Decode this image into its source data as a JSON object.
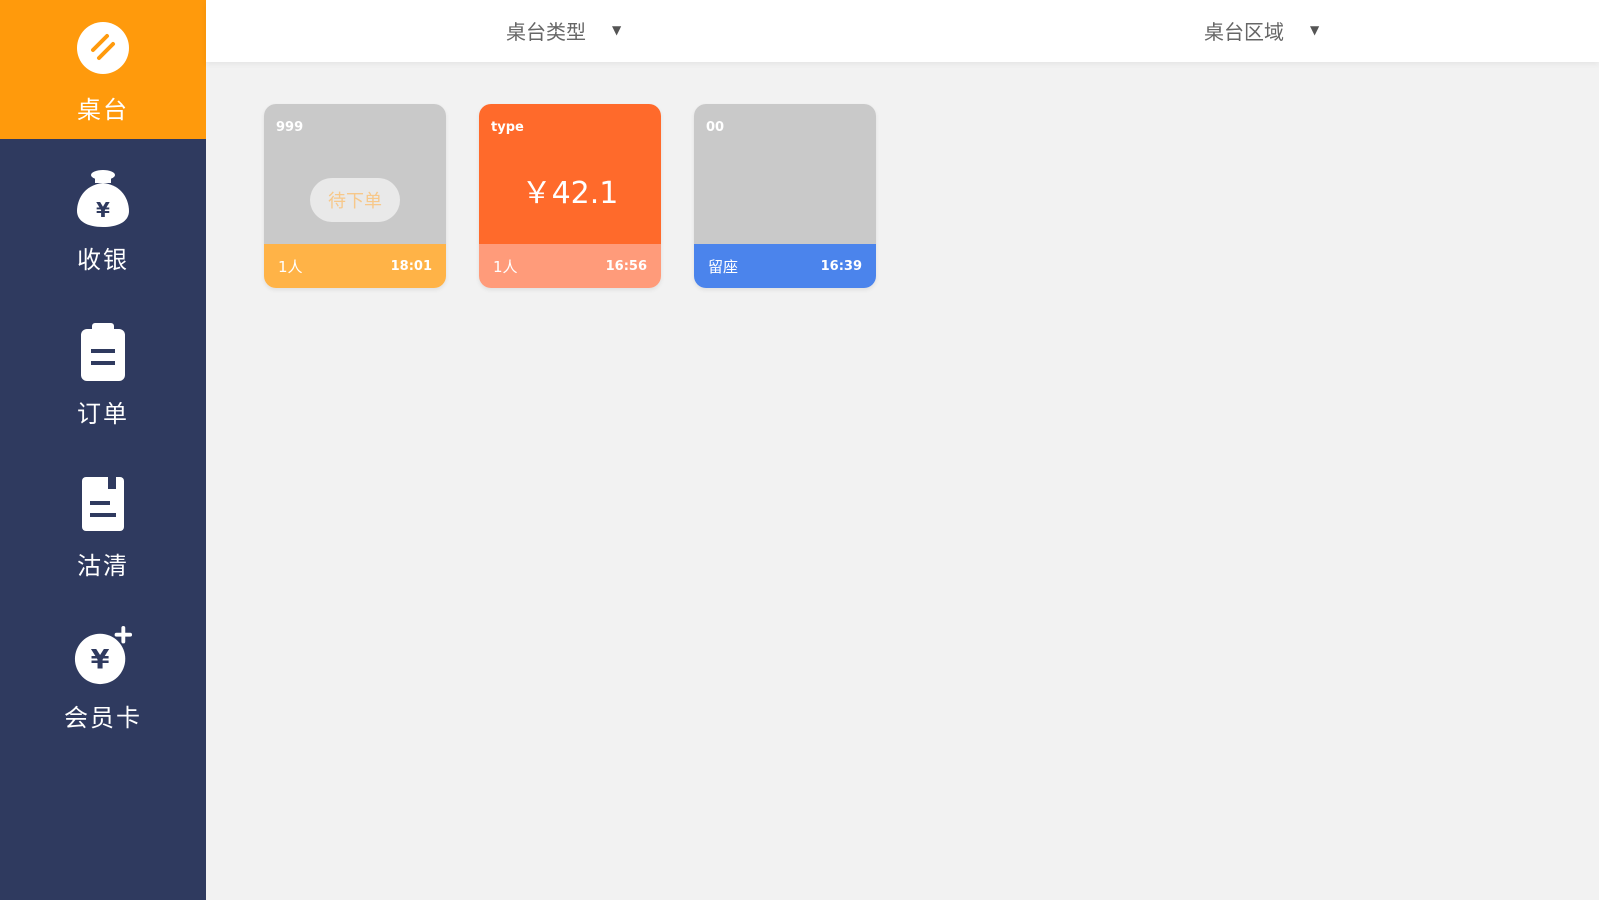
{
  "colors": {
    "sidebar_bg": "#2f3a5f",
    "active_accent": "#ff9a0c",
    "page_bg": "#f2f2f2",
    "card_idle_top": "#c9c9c9",
    "card_pending_bottom": "#ffb347",
    "card_dining_top": "#ff6a2b",
    "card_dining_bottom": "#ff9b7a",
    "card_cleaning_bottom": "#4b84ec"
  },
  "sidebar": {
    "items": [
      {
        "label": "桌台",
        "icon": "table-icon",
        "active": true
      },
      {
        "label": "收银",
        "icon": "money-bag-icon",
        "active": false
      },
      {
        "label": "订单",
        "icon": "clipboard-icon",
        "active": false
      },
      {
        "label": "沽清",
        "icon": "document-icon",
        "active": false
      },
      {
        "label": "会员卡",
        "icon": "yuan-coin-icon",
        "active": false
      }
    ]
  },
  "header": {
    "filters": [
      {
        "label": "桌台类型",
        "icon": "caret-down-icon"
      },
      {
        "label": "桌台区域",
        "icon": "caret-down-icon"
      }
    ]
  },
  "tables": [
    {
      "name": "999",
      "status_label": "待下单",
      "guests": "1人",
      "time": "18:01"
    },
    {
      "name": "type",
      "price": "￥42.1",
      "guests": "1人",
      "time": "16:56"
    },
    {
      "name": "00",
      "status_text": "留座",
      "time": "16:39"
    }
  ]
}
